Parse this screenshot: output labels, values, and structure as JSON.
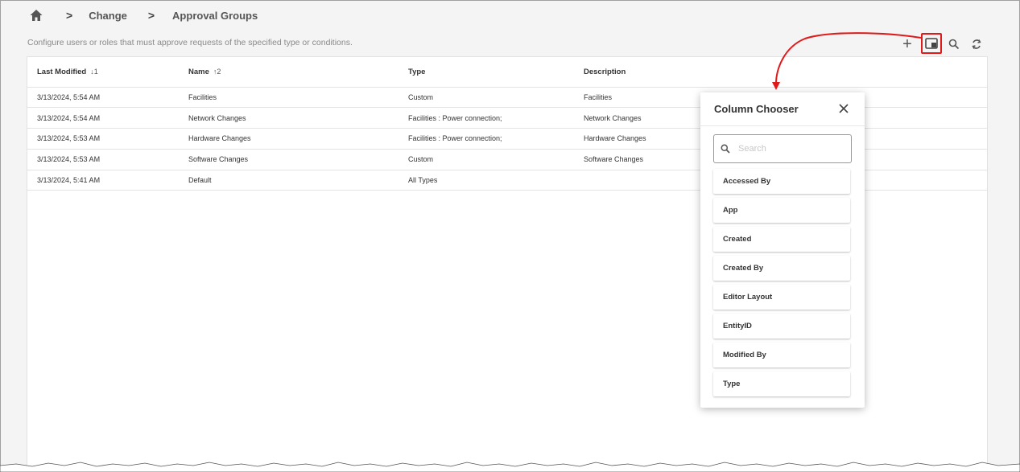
{
  "breadcrumb": {
    "home_icon": "home-icon",
    "separator": ">",
    "items": [
      "Change",
      "Approval Groups"
    ]
  },
  "subtitle": "Configure users or roles that must approve requests of the specified type or conditions.",
  "toolbar": {
    "add_label": "+",
    "icons": [
      "add-icon",
      "column-chooser-icon",
      "search-icon",
      "refresh-icon"
    ]
  },
  "table": {
    "columns": [
      {
        "label": "Last Modified",
        "sort": "↓1"
      },
      {
        "label": "Name",
        "sort": "↑2"
      },
      {
        "label": "Type",
        "sort": ""
      },
      {
        "label": "Description",
        "sort": ""
      }
    ],
    "rows": [
      [
        "3/13/2024, 5:54 AM",
        "Facilities",
        "Custom",
        "Facilities"
      ],
      [
        "3/13/2024, 5:54 AM",
        "Network Changes",
        "Facilities : Power connection;",
        "Network Changes"
      ],
      [
        "3/13/2024, 5:53 AM",
        "Hardware Changes",
        "Facilities : Power connection;",
        "Hardware Changes"
      ],
      [
        "3/13/2024, 5:53 AM",
        "Software Changes",
        "Custom",
        "Software Changes"
      ],
      [
        "3/13/2024, 5:41 AM",
        "Default",
        "All Types",
        ""
      ]
    ]
  },
  "column_chooser": {
    "title": "Column Chooser",
    "search_placeholder": "Search",
    "items": [
      "Accessed By",
      "App",
      "Created",
      "Created By",
      "Editor Layout",
      "EntityID",
      "Modified By",
      "Type"
    ]
  },
  "colors": {
    "highlight": "#e01a1a",
    "background": "#f4f4f4"
  }
}
